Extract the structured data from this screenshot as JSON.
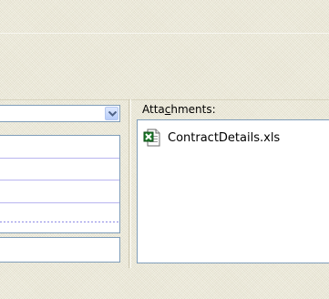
{
  "attachments": {
    "label": "Attachments:",
    "accesskey": "c",
    "files": [
      {
        "name": "ContractDetails.xls",
        "icon": "excel-file-icon"
      }
    ]
  },
  "colors": {
    "panel_background": "#ece9d8",
    "field_border": "#7f9db9",
    "list_line": "#b9b5f0",
    "excel_green": "#1e7a2c"
  }
}
